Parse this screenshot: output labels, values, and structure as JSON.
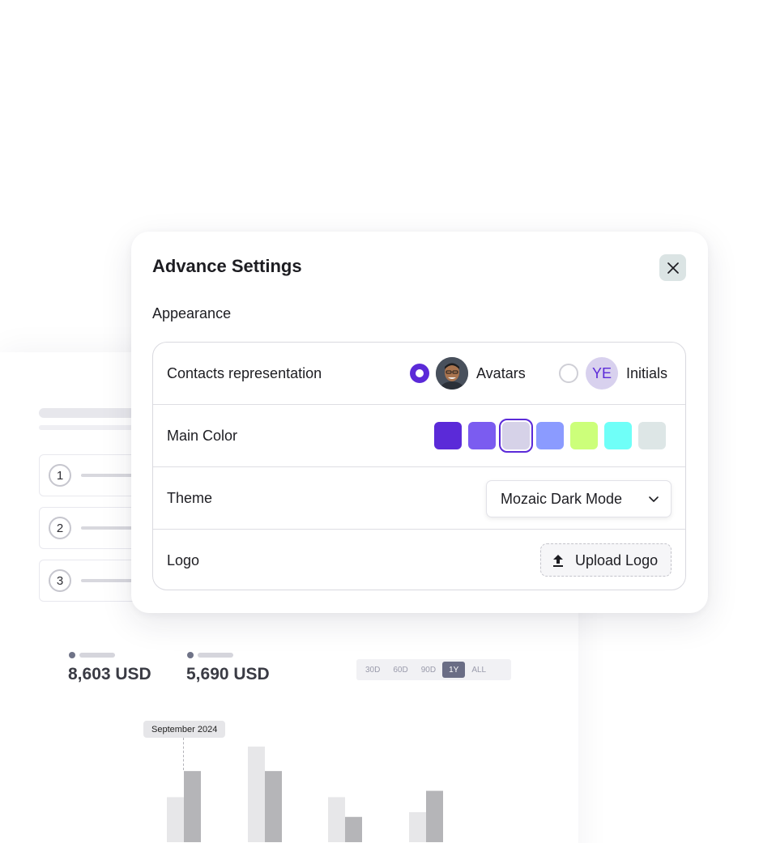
{
  "modal": {
    "title": "Advance Settings",
    "section": "Appearance",
    "rows": {
      "contacts": {
        "label": "Contacts representation",
        "option_avatars": "Avatars",
        "option_initials": "Initials",
        "initials_text": "YE",
        "selected": "Avatars"
      },
      "main_color": {
        "label": "Main Color",
        "swatches": [
          "#5b2ad8",
          "#7b5cf0",
          "#d6d2e8",
          "#8b9bff",
          "#ccff7a",
          "#6ffff8",
          "#dde6e6"
        ],
        "selected": "#d6d2e8"
      },
      "theme": {
        "label": "Theme",
        "value": "Mozaic Dark Mode"
      },
      "logo": {
        "label": "Logo",
        "button": "Upload Logo"
      }
    },
    "colors": {
      "accent": "#5b2ad8",
      "close_bg": "#dbe4e4"
    }
  },
  "background": {
    "steps": [
      "1",
      "2",
      "3"
    ],
    "stats": [
      "8,603 USD",
      "5,690 USD"
    ],
    "range_tabs": [
      "30D",
      "60D",
      "90D",
      "1Y",
      "ALL"
    ],
    "range_selected": "1Y",
    "tooltip": "September 2024"
  },
  "chart_data": {
    "type": "bar",
    "title": "",
    "xlabel": "",
    "ylabel": "",
    "categories": [
      "",
      "",
      "",
      ""
    ],
    "series": [
      {
        "values": [
          57,
          121,
          57,
          38
        ]
      },
      {
        "values": [
          90,
          90,
          32,
          65
        ]
      }
    ],
    "ylim": [
      0,
      125
    ],
    "grid": false
  }
}
